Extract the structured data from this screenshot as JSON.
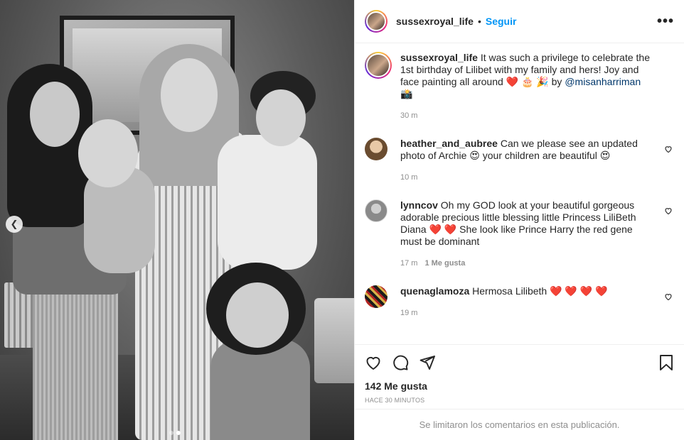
{
  "post": {
    "author": "sussexroyal_life",
    "separator": "•",
    "follow_label": "Seguir",
    "more_label": "•••",
    "photo_alt": "Foto de la publicación",
    "carousel": {
      "dots": 2,
      "active": 1
    }
  },
  "caption": {
    "user": "sussexroyal_life",
    "text_before": " It was such a privilege to celebrate the 1st birthday of Lilibet with my family and hers! Joy and face painting all around ",
    "emojis": "❤️ 🎂 🎉",
    "by": " by ",
    "mention": "@misanharriman",
    "after": " 📸",
    "time": "30 m"
  },
  "comments": [
    {
      "user": "heather_and_aubree",
      "text": " Can we please see an updated photo of Archie 😍 your children are beautiful 😍",
      "time": "10 m",
      "likes": ""
    },
    {
      "user": "lynncov",
      "text": " Oh my GOD look at your beautiful gorgeous adorable precious little blessing little Princess LiliBeth Diana ❤️ ❤️ She look like Prince Harry the red gene must be dominant",
      "time": "17 m",
      "likes": "1 Me gusta"
    },
    {
      "user": "quenaglamoza",
      "text": " Hermosa Lilibeth ❤️ ❤️ ❤️ ❤️",
      "time": "19 m",
      "likes": ""
    }
  ],
  "actions": {
    "like_icon": "heart-icon",
    "comment_icon": "comment-icon",
    "share_icon": "share-icon",
    "save_icon": "bookmark-icon"
  },
  "stats": {
    "likes": "142 Me gusta",
    "posted": "HACE 30 MINUTOS"
  },
  "footer": {
    "notice": "Se limitaron los comentarios en esta publicación."
  },
  "colors": {
    "accent": "#0095f6",
    "text": "#262626",
    "muted": "#8e8e8e",
    "heart": "#ed1c24"
  }
}
